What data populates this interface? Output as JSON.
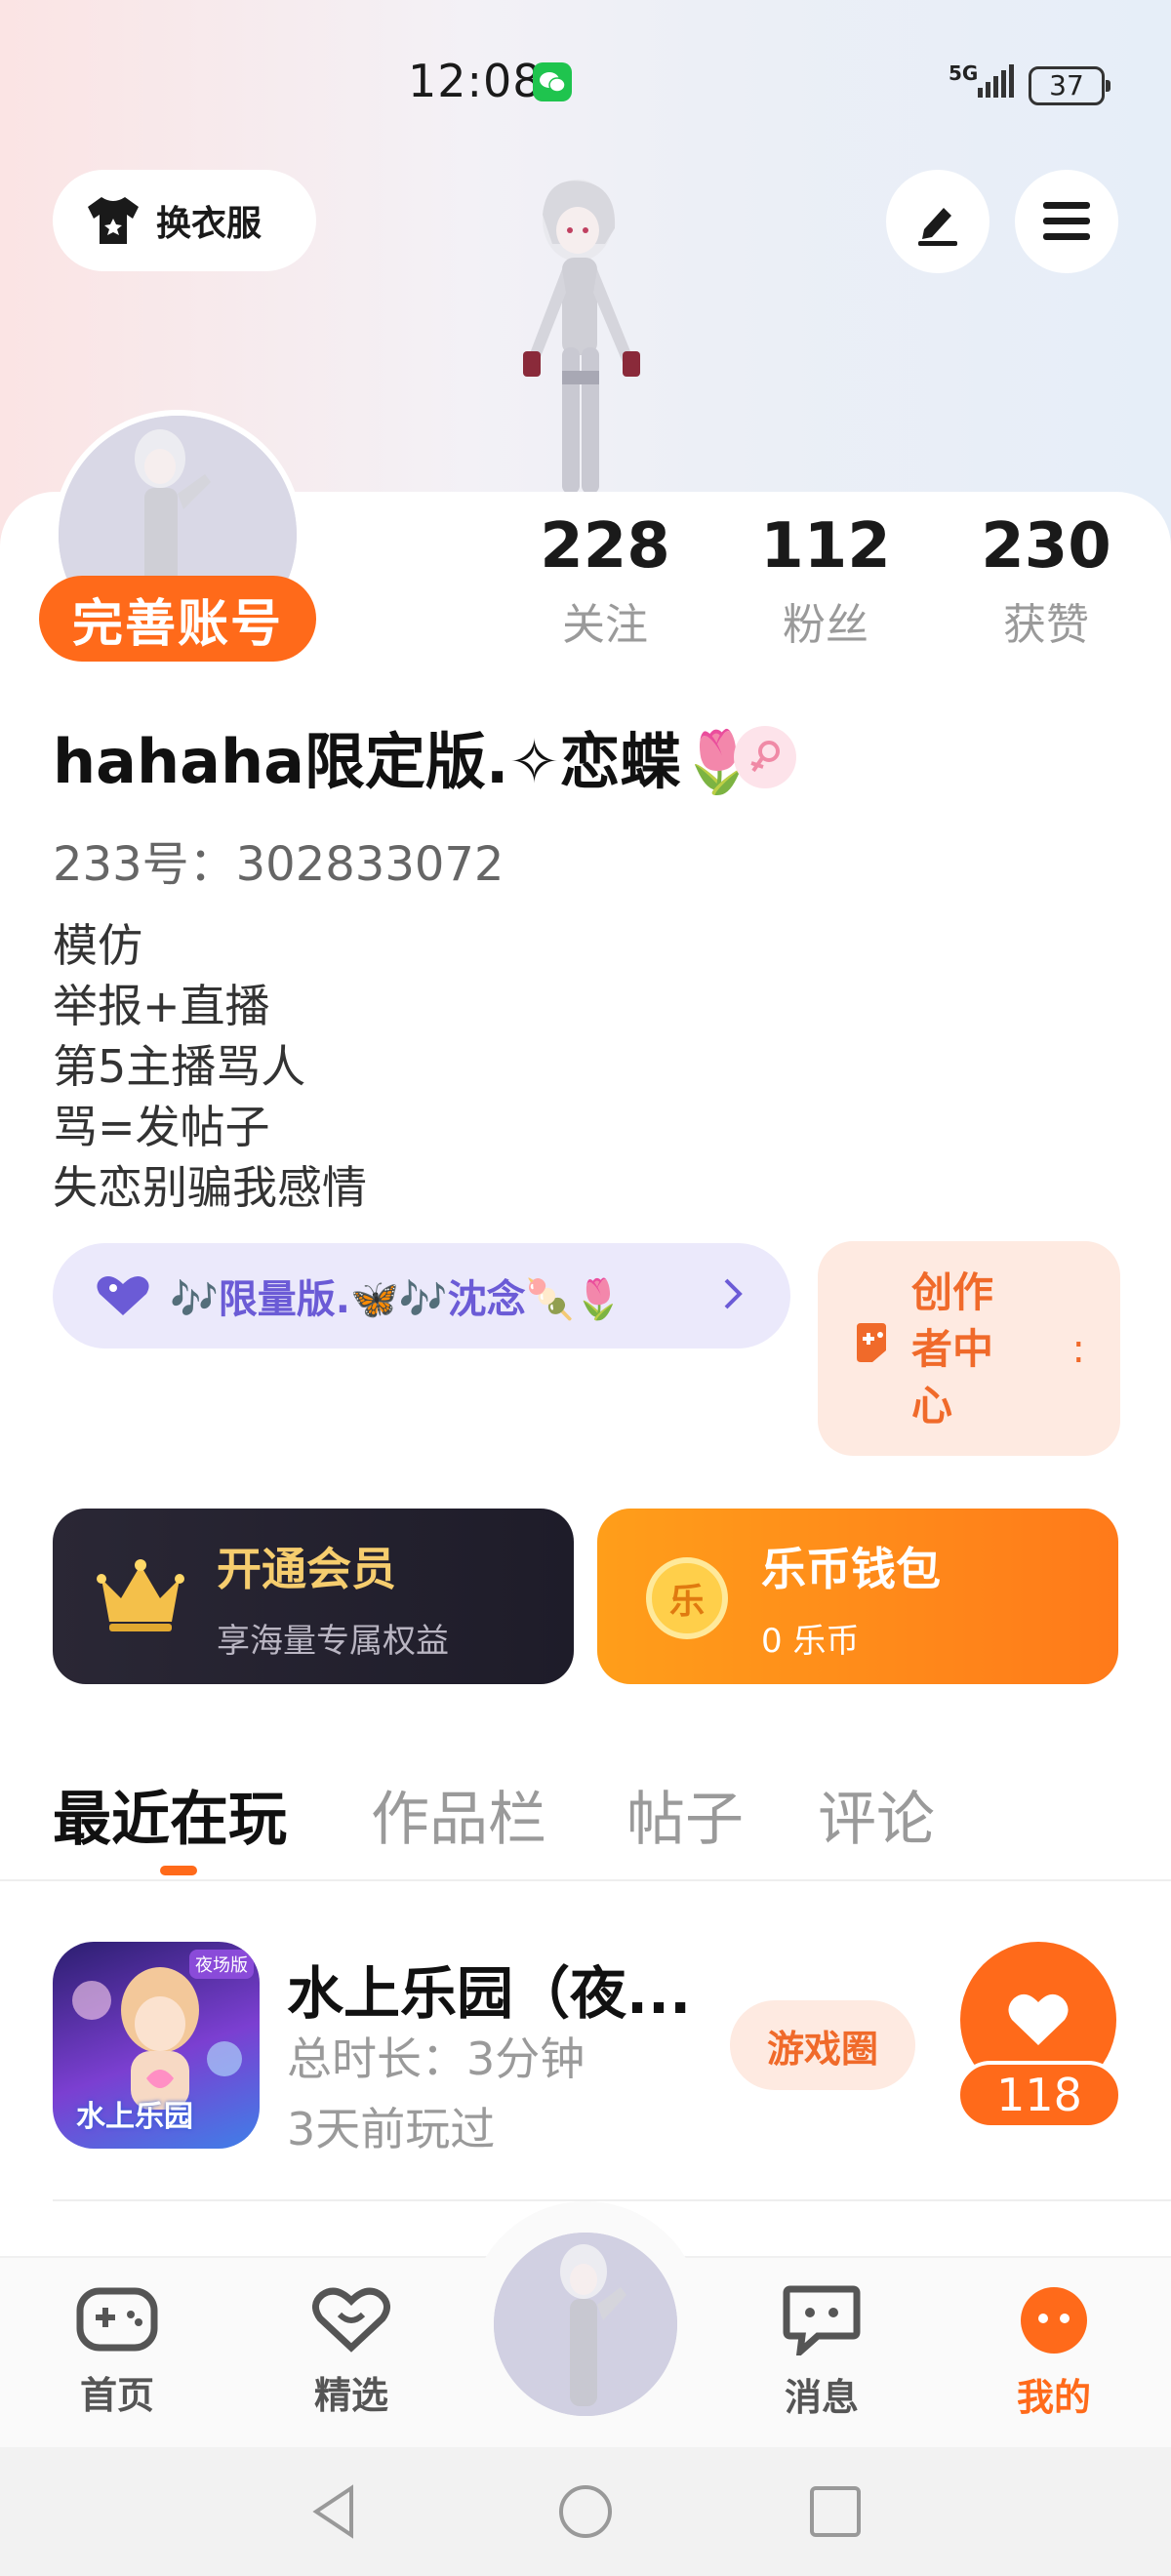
{
  "status": {
    "time": "12:08",
    "network": "5G",
    "battery": "37"
  },
  "header": {
    "outfit_label": "换衣服"
  },
  "profile": {
    "complete_label": "完善账号",
    "stats": [
      {
        "value": "228",
        "label": "关注"
      },
      {
        "value": "112",
        "label": "粉丝"
      },
      {
        "value": "230",
        "label": "获赞"
      }
    ],
    "nickname": "hahaha限定版.✧恋蝶🌷",
    "uid": "233号：302833072",
    "bio": [
      "模仿",
      "举报+直播",
      "第5主播骂人",
      "骂=发帖子",
      "失恋别骗我感情"
    ],
    "music": "🎶限量版.🦋🎶沈念🍡🌷",
    "creator": {
      "label": "创作者中心",
      "dots": ":"
    }
  },
  "vip": {
    "title": "开通会员",
    "subtitle": "享海量专属权益"
  },
  "wallet": {
    "title": "乐币钱包",
    "subtitle": "0 乐币",
    "coin_char": "乐"
  },
  "tabs": [
    "最近在玩",
    "作品栏",
    "帖子",
    "评论"
  ],
  "games": [
    {
      "title": "水上乐园（夜...",
      "duration": "总时长：3分钟",
      "last_played": "3天前玩过",
      "circle_label": "游戏圈",
      "likes": "118",
      "icon_badge": "夜场版",
      "icon_text": "水上乐园"
    }
  ],
  "nav": [
    "首页",
    "精选",
    "消息",
    "我的"
  ],
  "colors": {
    "accent": "#ff6a1a",
    "purple": "#6b5bd6"
  }
}
